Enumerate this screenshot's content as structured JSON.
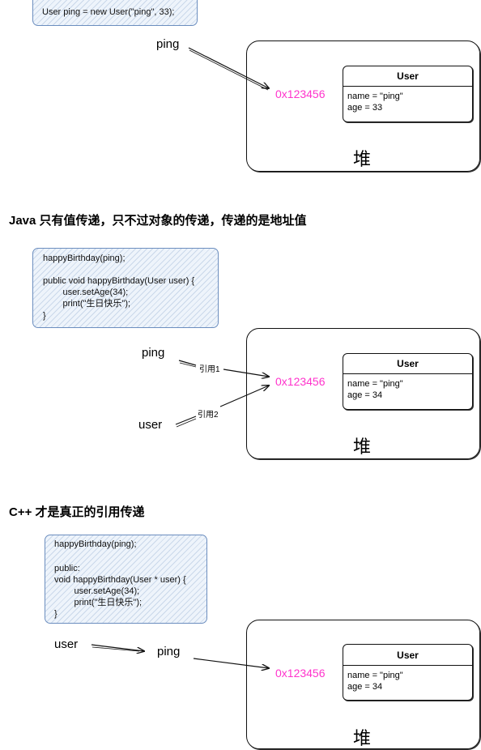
{
  "sections": [
    {
      "code": [
        "User ping = new User(\"ping\", 33);"
      ],
      "vars": [
        "ping"
      ],
      "refs": [],
      "address": "0x123456",
      "object": {
        "title": "User",
        "fields": [
          "name = \"ping\"",
          "age = 33"
        ]
      },
      "heap_label": "堆"
    },
    {
      "heading": "Java 只有值传递，只不过对象的传递，传递的是地址值",
      "code": [
        "happyBirthday(ping);",
        "",
        "public void happyBirthday(User user) {",
        "        user.setAge(34);",
        "        print(\"生日快乐\");",
        "}"
      ],
      "vars": [
        "ping",
        "user"
      ],
      "refs": [
        "引用1",
        "引用2"
      ],
      "address": "0x123456",
      "object": {
        "title": "User",
        "fields": [
          "name = \"ping\"",
          "age = 34"
        ]
      },
      "heap_label": "堆"
    },
    {
      "heading": "C++ 才是真正的引用传递",
      "code": [
        "happyBirthday(ping);",
        "",
        "public:",
        "void happyBirthday(User * user) {",
        "        user.setAge(34);",
        "        print(\"生日快乐\");",
        "}"
      ],
      "vars": [
        "user",
        "ping"
      ],
      "refs": [],
      "address": "0x123456",
      "object": {
        "title": "User",
        "fields": [
          "name = \"ping\"",
          "age = 34"
        ]
      },
      "heap_label": "堆"
    }
  ],
  "colors": {
    "address": "#ff33cc",
    "code_border": "#6c8ebf",
    "code_fill": "#eef4fb"
  }
}
